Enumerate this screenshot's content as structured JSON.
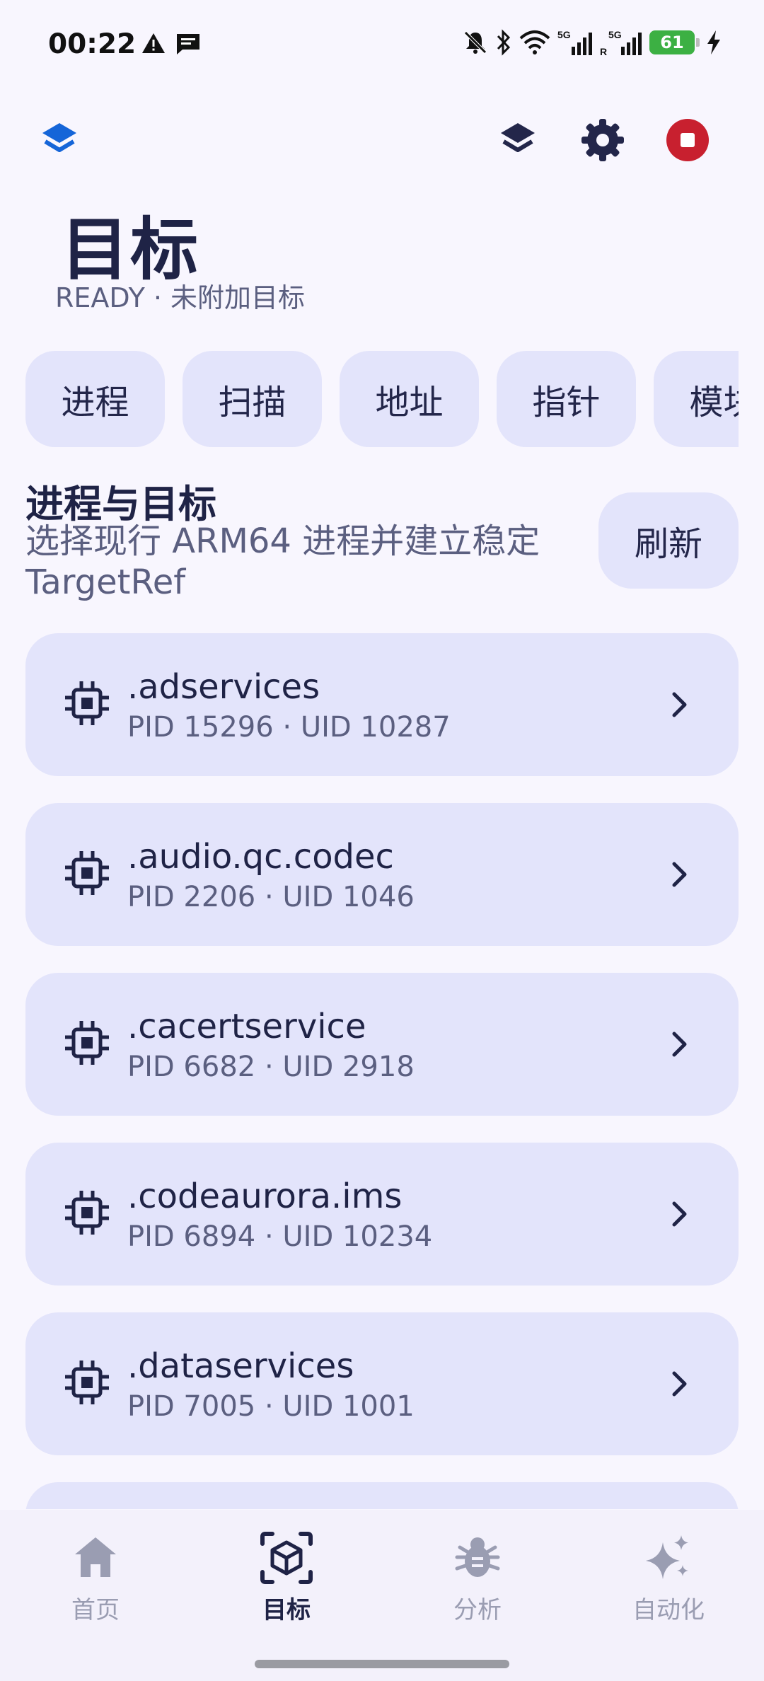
{
  "status_bar": {
    "time": "00:22",
    "battery": "61",
    "icons": [
      "alert-icon",
      "message-icon",
      "silent-bell-icon",
      "bluetooth-icon",
      "wifi-icon",
      "signal-5g-icon",
      "signal-5g-r-icon",
      "charging-icon"
    ]
  },
  "topbar": {
    "icons": [
      "layers-icon",
      "layers-icon",
      "settings-icon",
      "stop-icon"
    ],
    "accent_color": "#1565D8",
    "stop_color": "#C8202F"
  },
  "page": {
    "title": "目标",
    "subtitle": "READY · 未附加目标"
  },
  "tabs": [
    {
      "label": "进程"
    },
    {
      "label": "扫描"
    },
    {
      "label": "地址"
    },
    {
      "label": "指针"
    },
    {
      "label": "模块"
    }
  ],
  "section": {
    "title": "进程与目标",
    "description": "选择现行 ARM64 进程并建立稳定 TargetRef",
    "refresh_label": "刷新"
  },
  "processes": [
    {
      "name": ".adservices",
      "meta": "PID 15296 · UID 10287"
    },
    {
      "name": ".audio.qc.codec",
      "meta": "PID 2206 · UID 1046"
    },
    {
      "name": ".cacertservice",
      "meta": "PID 6682 · UID 2918"
    },
    {
      "name": ".codeaurora.ims",
      "meta": "PID 6894 · UID 10234"
    },
    {
      "name": ".dataservices",
      "meta": "PID 7005 · UID 1001"
    },
    {
      "name": "",
      "meta": ""
    }
  ],
  "bottom_nav": [
    {
      "label": "首页",
      "icon": "home-icon"
    },
    {
      "label": "目标",
      "icon": "target-cube-icon",
      "active": true
    },
    {
      "label": "分析",
      "icon": "bug-icon"
    },
    {
      "label": "自动化",
      "icon": "sparkle-icon"
    }
  ]
}
